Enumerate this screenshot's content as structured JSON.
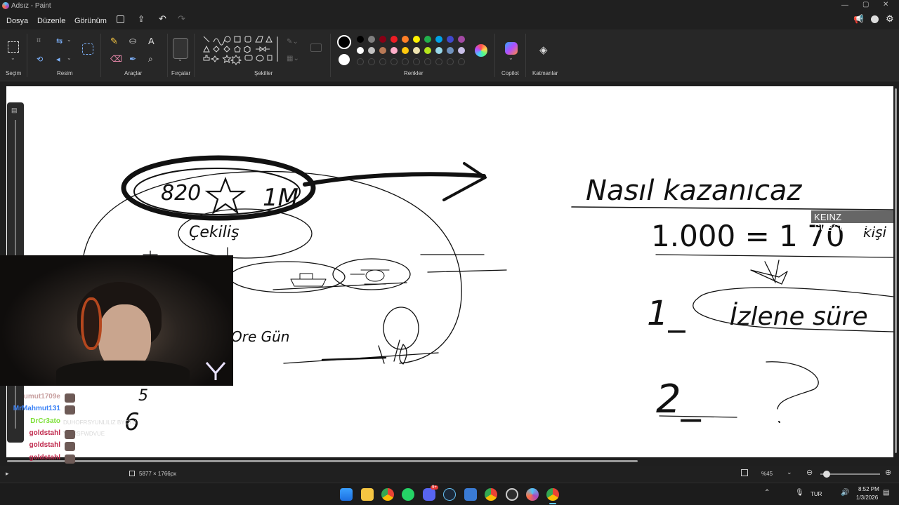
{
  "window": {
    "title": "Adsız - Paint"
  },
  "menu": {
    "file": "Dosya",
    "edit": "Düzenle",
    "view": "Görünüm"
  },
  "ribbon": {
    "groups": {
      "selection": "Seçim",
      "image": "Resim",
      "tools": "Araçlar",
      "brushes": "Fırçalar",
      "shapes": "Şekiller",
      "colors": "Renkler",
      "copilot": "Copilot",
      "layers": "Katmanlar"
    },
    "palette_row1": [
      "#000000",
      "#7f7f7f",
      "#880015",
      "#ed1c24",
      "#ff7f27",
      "#fff200",
      "#22b14c",
      "#00a2e8",
      "#3f48cc",
      "#a349a4"
    ],
    "palette_row2": [
      "#ffffff",
      "#c3c3c3",
      "#b97a57",
      "#ffaec9",
      "#ffc90e",
      "#efe4b0",
      "#b5e61d",
      "#99d9ea",
      "#7092be",
      "#c8bfe7"
    ],
    "primary_color": "#000000",
    "secondary_color": "#ffffff"
  },
  "overlay": {
    "subscriber_banner": "KEINZ SUBSCRIBER"
  },
  "drawing_text": {
    "top_left_number": "820",
    "top_left_suffix": "1M",
    "left_word": "Çekiliş",
    "left_bottom": "Ore Gün",
    "right_title": "Nasıl kazanıcaz",
    "equation": "1.000 = 1 70",
    "equation_suffix": "kişi",
    "item1": "1_",
    "item1_text": "İzlene süre",
    "item2": "2_",
    "item2_text": "?",
    "small_digits": "5",
    "small_digit2": "6"
  },
  "chat": [
    {
      "user": "umut1709e",
      "color": "#c8a0a0",
      "message": ""
    },
    {
      "user": "MrMahmut131",
      "color": "#3b82f6",
      "message": ""
    },
    {
      "user": "DrCr3ato",
      "color": "#7fe03a",
      "message": "DUHOFRSYUNLILIZ BYCTU YICRSFWDVUE"
    },
    {
      "user": "goldstahl",
      "color": "#c0284c",
      "message": ""
    },
    {
      "user": "goldstahl",
      "color": "#c0284c",
      "message": ""
    },
    {
      "user": "goldstahl",
      "color": "#c0284c",
      "message": ""
    },
    {
      "user": "goldstahl",
      "color": "#c0284c",
      "message": ""
    },
    {
      "user": "goldstahl",
      "color": "#c0284c",
      "message": ""
    }
  ],
  "status": {
    "canvas_size": "5877 × 1766px",
    "zoom": "%45"
  },
  "taskbar": {
    "language": "TUR",
    "time": "8:52 PM",
    "date": "1/3/2026",
    "notification_badge": "9+"
  }
}
